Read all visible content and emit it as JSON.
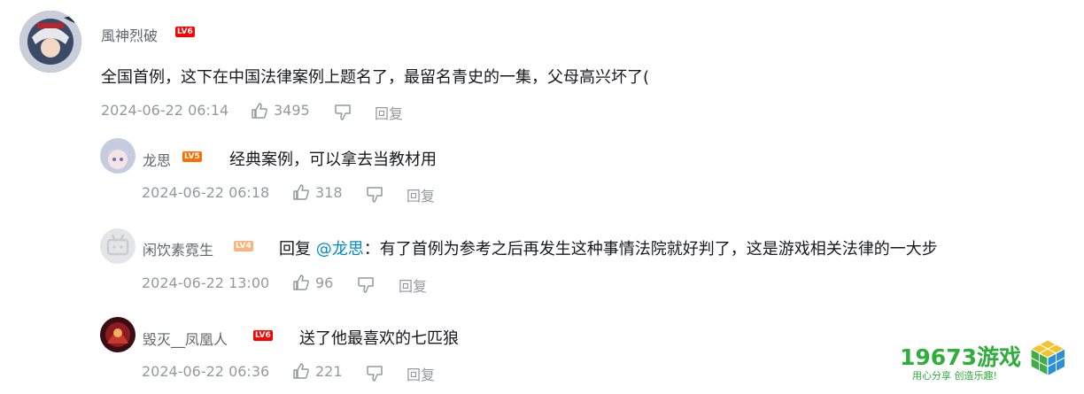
{
  "comments": [
    {
      "username": "風神烈破",
      "level": "LV6",
      "text": "全国首例，这下在中国法律案例上题名了，最留名青史的一集，父母高兴坏了(",
      "time": "2024-06-22 06:14",
      "likes": "3495",
      "reply_label": "回复"
    }
  ],
  "replies": [
    {
      "username": "龙思",
      "level": "LV5",
      "text": "经典案例，可以拿去当教材用",
      "time": "2024-06-22 06:18",
      "likes": "318",
      "reply_label": "回复"
    },
    {
      "username": "闲饮素霓生",
      "level": "LV4",
      "reply_prefix": "回复 ",
      "mention": "@龙思",
      "separator": "：",
      "text": "有了首例为参考之后再发生这种事情法院就好判了，这是游戏相关法律的一大步",
      "time": "2024-06-22 13:00",
      "likes": "96",
      "reply_label": "回复"
    },
    {
      "username": "毁灭__凤凰人",
      "level": "LV6",
      "text": "送了他最喜欢的七匹狼",
      "time": "2024-06-22 06:36",
      "likes": "221",
      "reply_label": "回复"
    }
  ],
  "colors": {
    "lv4": "#ffb37c",
    "lv5": "#ff6c00",
    "lv6": "#ff0000",
    "mention": "#008ac5",
    "meta": "#9499a0",
    "watermark_green": "#2fae3b"
  },
  "watermark": {
    "brand": "19673游戏",
    "slogan": "用心分享  创造乐趣!"
  },
  "icons": {
    "like": "thumbs-up-icon",
    "dislike": "thumbs-down-icon",
    "logo": "cube-logo-icon"
  }
}
